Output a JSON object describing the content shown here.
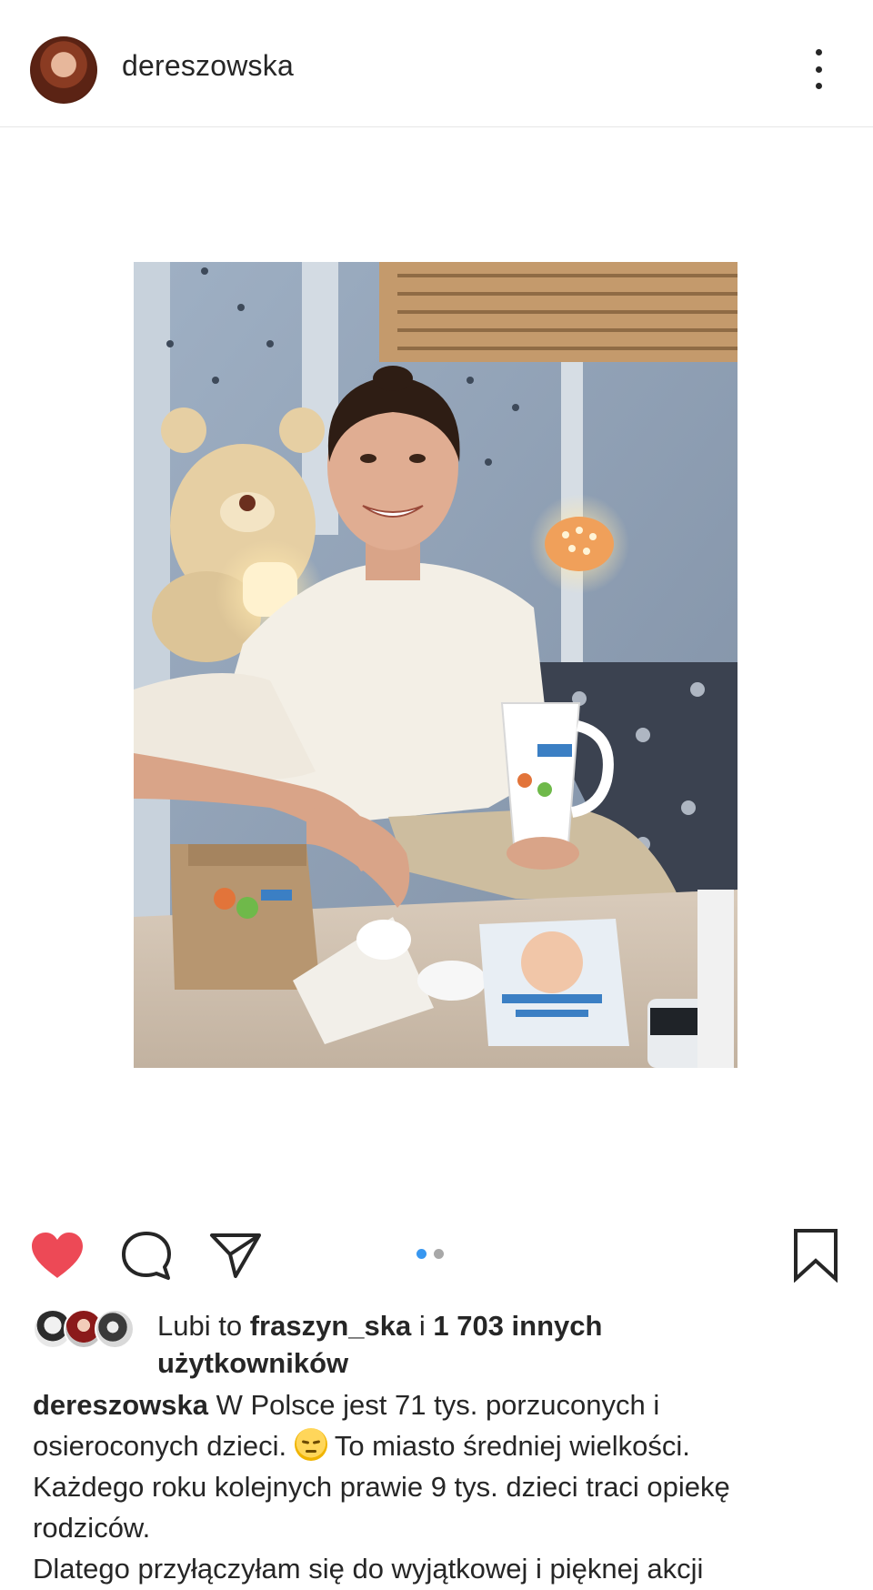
{
  "post": {
    "username": "dereszowska",
    "more_icon": "more-vertical-icon",
    "photo_description_icon": "post-photo"
  },
  "actions": {
    "like_icon": "heart-filled-icon",
    "like_color": "#ed4956",
    "comment_icon": "comment-icon",
    "share_icon": "send-icon",
    "save_icon": "bookmark-icon",
    "carousel_active_index": 0,
    "carousel_count": 2,
    "carousel_active_color": "#3897f0"
  },
  "likes": {
    "prefix": "Lubi to",
    "liker": "fraszyn_ska",
    "connector": "i",
    "count_text": "1 703 innych użytkowników"
  },
  "caption": {
    "username": "dereszowska",
    "line1_text": "W Polsce jest 71 tys. porzuconych i osieroconych dzieci.",
    "emoji": "pensive-face-emoji",
    "line1_after": "To miasto średniej wielkości.",
    "line2": "Każdego roku kolejnych prawie 9 tys. dzieci traci opiekę rodziców.",
    "line3": "Dlatego  przyłączyłam się do wyjątkowej i pięknej akcji"
  }
}
